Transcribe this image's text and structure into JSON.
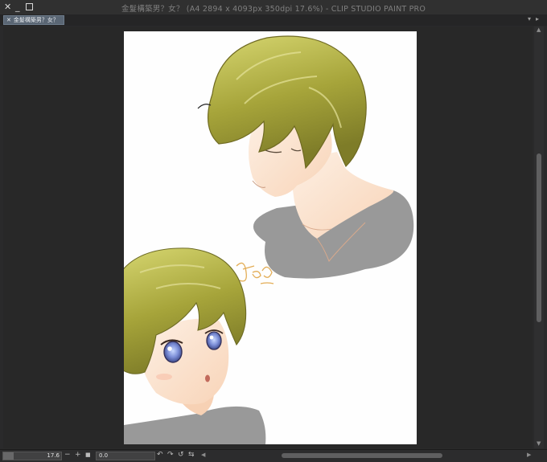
{
  "window": {
    "title": "金髮構築男？女？ (A4 2894 x 4093px 350dpi 17.6%)  - CLIP STUDIO PAINT PRO",
    "close_glyph": "✕",
    "minimize_glyph": "_"
  },
  "document_tab": {
    "close_glyph": "✕",
    "label": "金髮構築男？女？"
  },
  "tab_scroll": {
    "down": "▾",
    "right": "▸"
  },
  "statusbar": {
    "zoom_value": "17.6",
    "zoom_fraction": 0.176,
    "zoom_out": "−",
    "zoom_in": "+",
    "stop": "■",
    "rotation_value": "0.0",
    "rotate_left": "↶",
    "rotate_right": "↷",
    "reset": "↺",
    "flip": "⇆"
  },
  "scroll_arrows": {
    "up": "▲",
    "down": "▼",
    "left": "◀",
    "right": "▶"
  },
  "colors": {
    "app_background": "#2a2a2b",
    "canvas_background": "#282828",
    "paper": "#fefefe",
    "hair": "#b5ad3e",
    "skin": "#fbe3cf",
    "shirt": "#9a9a9a",
    "tab_active": "#5a6674"
  }
}
